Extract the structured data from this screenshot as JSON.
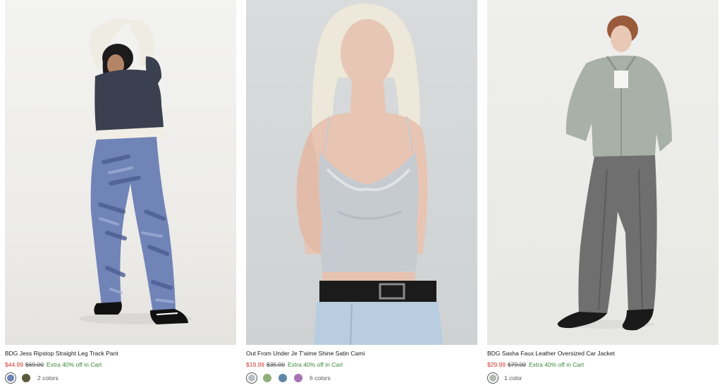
{
  "products": [
    {
      "title": "BDG Jess Ripstop Straight Leg Track Pant",
      "sale_price": "$44.99",
      "original_price": "$69.00",
      "promo": "Extra 40% off in Cart",
      "color_count": "2 colors",
      "swatch_colors": [
        "#6f82b5",
        "#5b5a3c"
      ],
      "image_icon": "product-photo-track-pant"
    },
    {
      "title": "Out From Under Je T'aime Shine Satin Cami",
      "sale_price": "$19.99",
      "original_price": "$35.00",
      "promo": "Extra 40% off in Cart",
      "color_count": "6 colors",
      "swatch_colors": [
        "#b9bfc6",
        "#8fb07a",
        "#5e88a8",
        "#a874b8"
      ],
      "image_icon": "product-photo-satin-cami"
    },
    {
      "title": "BDG Sasha Faux Leather Oversized Car Jacket",
      "sale_price": "$29.99",
      "original_price": "$79.00",
      "promo": "Extra 40% off in Cart",
      "color_count": "1 color",
      "swatch_colors": [
        "#b4b9b2"
      ],
      "image_icon": "product-photo-car-jacket"
    }
  ],
  "colors": {
    "sale": "#d0372b",
    "promo": "#3a8a3a",
    "text": "#1a1a1a"
  }
}
